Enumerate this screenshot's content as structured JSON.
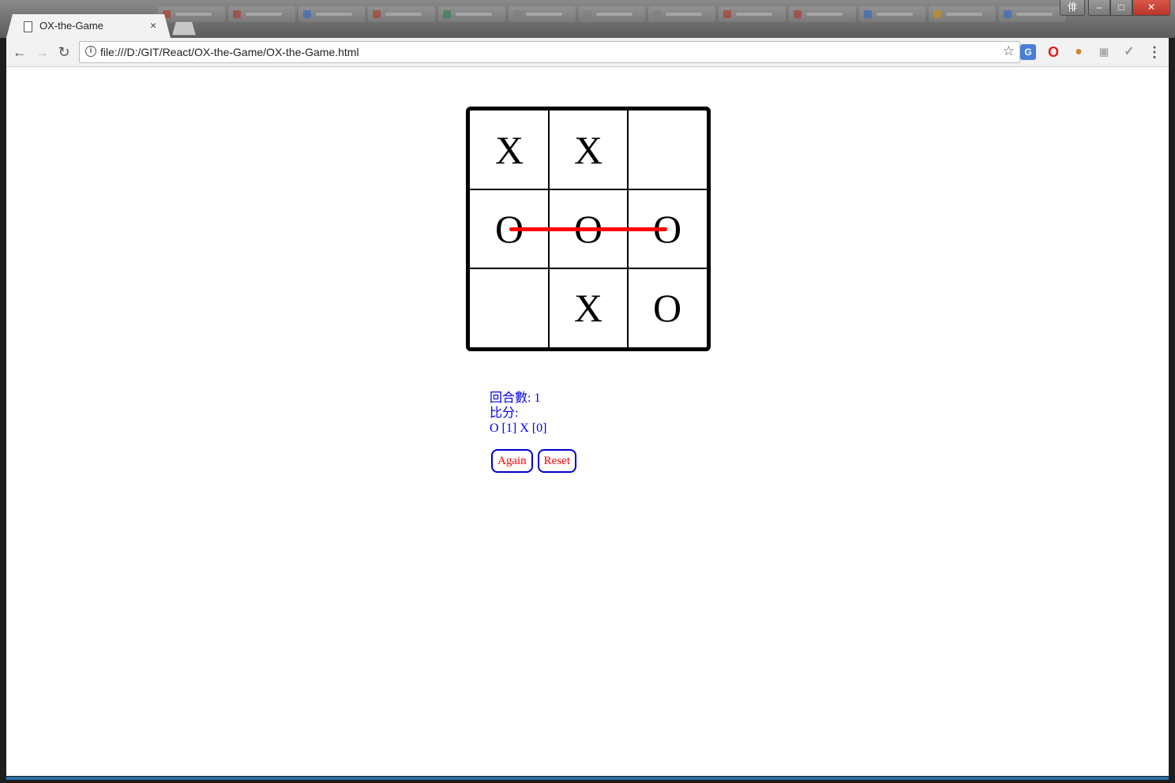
{
  "browser": {
    "tab_title": "OX-the-Game",
    "tab_close": "×",
    "url": "file:///D:/GIT/React/OX-the-Game/OX-the-Game.html",
    "nav": {
      "back": "←",
      "forward": "→",
      "reload": "↻"
    },
    "star": "☆",
    "menu": "⋮",
    "window_buttons": {
      "user": "俳",
      "minimize": "–",
      "maximize": "□",
      "close": "✕"
    },
    "background_tab_colors": [
      "#c0392b",
      "#c0392b",
      "#2e6fd8",
      "#c0392b",
      "#2e8b57",
      "#888888",
      "#888888",
      "#888888",
      "#c0392b",
      "#c0392b",
      "#2e6fd8",
      "#d4a017",
      "#2e6fd8"
    ]
  },
  "game": {
    "cells": [
      [
        "X",
        "X",
        ""
      ],
      [
        "O",
        "O",
        "O"
      ],
      [
        "",
        "X",
        "O"
      ]
    ],
    "winning_line": "row-2",
    "win_line_color": "#ff0000",
    "round_label": "回合數: 1",
    "score_label": "比分:",
    "score_text": "O [1] X [0]",
    "again_label": "Again",
    "reset_label": "Reset"
  }
}
